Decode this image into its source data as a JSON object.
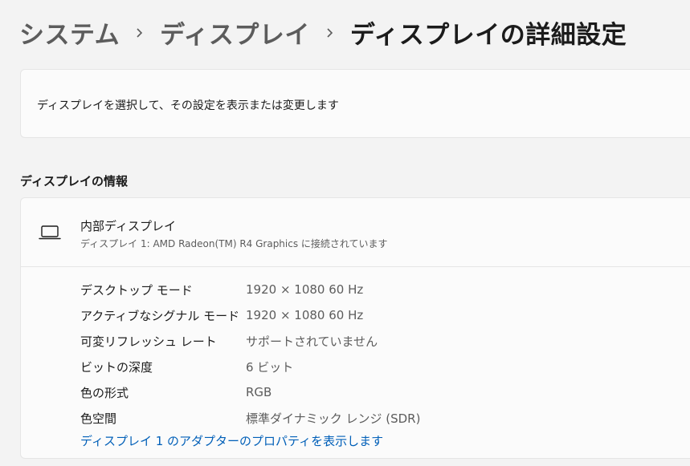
{
  "breadcrumb": {
    "items": [
      "システム",
      "ディスプレイ",
      "ディスプレイの詳細設定"
    ]
  },
  "select_card": {
    "text": "ディスプレイを選択して、その設定を表示または変更します"
  },
  "info_section": {
    "title": "ディスプレイの情報",
    "display_name": "内部ディスプレイ",
    "display_subtitle": "ディスプレイ 1: AMD Radeon(TM) R4 Graphics に接続されています",
    "rows": [
      {
        "label": "デスクトップ モード",
        "value": "1920 × 1080 60 Hz"
      },
      {
        "label": "アクティブなシグナル モード",
        "value": "1920 × 1080 60 Hz"
      },
      {
        "label": "可変リフレッシュ レート",
        "value": "サポートされていません"
      },
      {
        "label": "ビットの深度",
        "value": "6 ビット"
      },
      {
        "label": "色の形式",
        "value": "RGB"
      },
      {
        "label": "色空間",
        "value": "標準ダイナミック レンジ (SDR)"
      }
    ],
    "adapter_link": "ディスプレイ 1 のアダプターのプロパティを表示します"
  },
  "icons": {
    "display": "laptop-icon",
    "separator": "chevron-right-icon"
  },
  "colors": {
    "background": "#f3f3f3",
    "card": "#fbfbfb",
    "link": "#005fb8",
    "secondary_text": "#5c5c5c"
  }
}
